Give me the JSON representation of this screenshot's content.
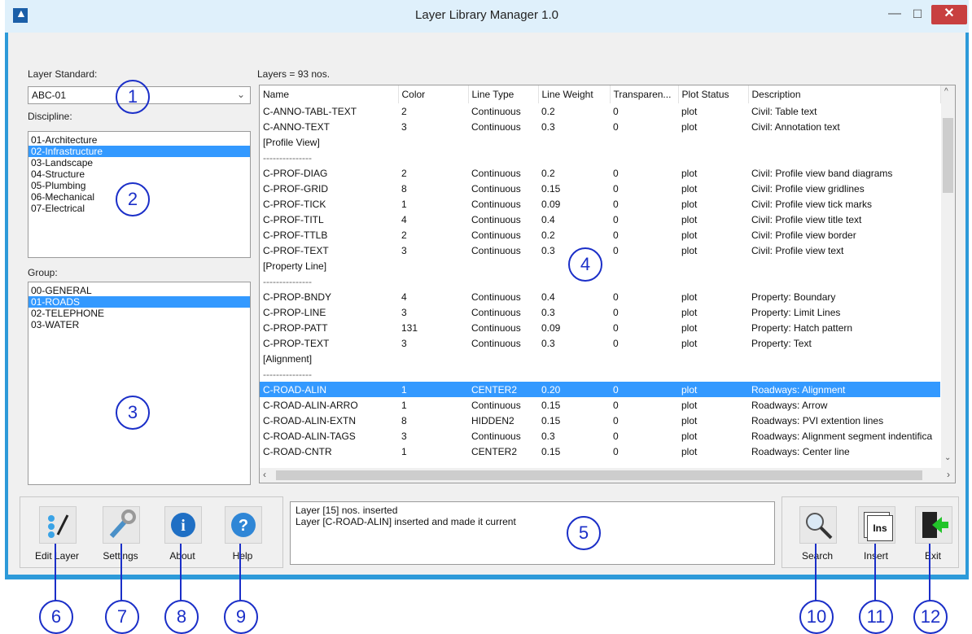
{
  "window": {
    "title": "Layer Library Manager 1.0"
  },
  "titlebar": {
    "minimize": "—",
    "maximize": "☐",
    "close": "✕"
  },
  "left": {
    "standard_label": "Layer Standard:",
    "standard_value": "ABC-01",
    "discipline_label": "Discipline:",
    "disciplines": [
      "01-Architecture",
      "02-Infrastructure",
      "03-Landscape",
      "04-Structure",
      "05-Plumbing",
      "06-Mechanical",
      "07-Electrical"
    ],
    "discipline_selected": 1,
    "group_label": "Group:",
    "groups": [
      "00-GENERAL",
      "01-ROADS",
      "02-TELEPHONE",
      "03-WATER"
    ],
    "group_selected": 1
  },
  "layers": {
    "count_label": "Layers = 93 nos.",
    "columns": [
      "Name",
      "Color",
      "Line Type",
      "Line Weight",
      "Transparen...",
      "Plot Status",
      "Description"
    ],
    "rows": [
      [
        "C-ANNO-TABL-TEXT",
        "2",
        "Continuous",
        "0.2",
        "0",
        "plot",
        "Civil: Table text"
      ],
      [
        "C-ANNO-TEXT",
        "3",
        "Continuous",
        "0.3",
        "0",
        "plot",
        "Civil: Annotation text"
      ],
      [
        "[Profile View]",
        "",
        "",
        "",
        "",
        "",
        ""
      ],
      [
        "---------------",
        "",
        "",
        "",
        "",
        "",
        ""
      ],
      [
        "C-PROF-DIAG",
        "2",
        "Continuous",
        "0.2",
        "0",
        "plot",
        "Civil: Profile view band diagrams"
      ],
      [
        "C-PROF-GRID",
        "8",
        "Continuous",
        "0.15",
        "0",
        "plot",
        "Civil: Profile view gridlines"
      ],
      [
        "C-PROF-TICK",
        "1",
        "Continuous",
        "0.09",
        "0",
        "plot",
        "Civil: Profile view tick marks"
      ],
      [
        "C-PROF-TITL",
        "4",
        "Continuous",
        "0.4",
        "0",
        "plot",
        "Civil:  Profile view title text"
      ],
      [
        "C-PROF-TTLB",
        "2",
        "Continuous",
        "0.2",
        "0",
        "plot",
        "Civil:  Profile view border"
      ],
      [
        "C-PROF-TEXT",
        "3",
        "Continuous",
        "0.3",
        "0",
        "plot",
        "Civil:  Profile view text"
      ],
      [
        "[Property Line]",
        "",
        "",
        "",
        "",
        "",
        ""
      ],
      [
        "---------------",
        "",
        "",
        "",
        "",
        "",
        ""
      ],
      [
        "C-PROP-BNDY",
        "4",
        "Continuous",
        "0.4",
        "0",
        "plot",
        "Property: Boundary"
      ],
      [
        "C-PROP-LINE",
        "3",
        "Continuous",
        "0.3",
        "0",
        "plot",
        "Property: Limit Lines"
      ],
      [
        "C-PROP-PATT",
        "131",
        "Continuous",
        "0.09",
        "0",
        "plot",
        "Property: Hatch pattern"
      ],
      [
        "C-PROP-TEXT",
        "3",
        "Continuous",
        "0.3",
        "0",
        "plot",
        "Property:  Text"
      ],
      [
        "[Alignment]",
        "",
        "",
        "",
        "",
        "",
        ""
      ],
      [
        "---------------",
        "",
        "",
        "",
        "",
        "",
        ""
      ],
      [
        "C-ROAD-ALIN",
        "1",
        "CENTER2",
        "0.20",
        "0",
        "plot",
        "Roadways: Alignment"
      ],
      [
        "C-ROAD-ALIN-ARRO",
        "1",
        "Continuous",
        "0.15",
        "0",
        "plot",
        "Roadways:  Arrow"
      ],
      [
        "C-ROAD-ALIN-EXTN",
        "8",
        "HIDDEN2",
        "0.15",
        "0",
        "plot",
        "Roadways:  PVI extention lines"
      ],
      [
        "C-ROAD-ALIN-TAGS",
        "3",
        "Continuous",
        "0.3",
        "0",
        "plot",
        "Roadways: Alignment segment indentifica"
      ],
      [
        "C-ROAD-CNTR",
        "1",
        "CENTER2",
        "0.15",
        "0",
        "plot",
        "Roadways: Center line"
      ]
    ],
    "selected_row": 18
  },
  "status": {
    "lines": [
      "Layer [15] nos. inserted",
      "Layer [C-ROAD-ALIN] inserted and made it current"
    ]
  },
  "toolbar": {
    "edit_layer": "Edit Layer",
    "settings": "Settings",
    "about": "About",
    "help": "Help",
    "search": "Search",
    "insert": "Insert",
    "exit": "Exit",
    "insert_icon_text": "Ins"
  },
  "callouts": [
    "1",
    "2",
    "3",
    "4",
    "5",
    "6",
    "7",
    "8",
    "9",
    "10",
    "11",
    "12"
  ],
  "colors": {
    "accent": "#2d9ad9",
    "selection": "#3399ff",
    "callout": "#1b2fc8"
  }
}
